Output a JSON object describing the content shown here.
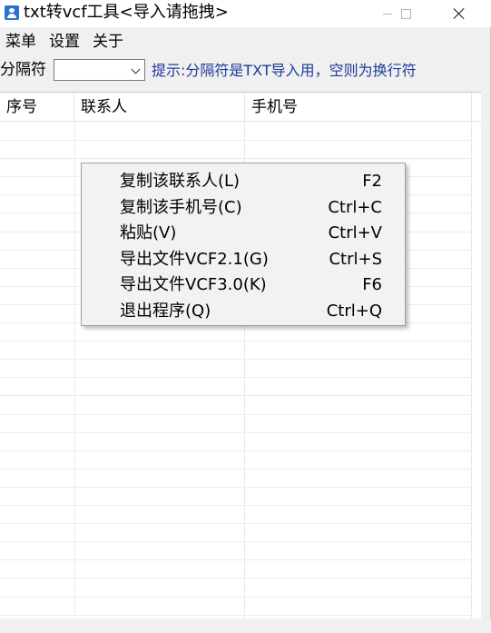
{
  "window": {
    "title": "txt转vcf工具<导入请拖拽>"
  },
  "menubar": {
    "items": [
      {
        "label": "菜单"
      },
      {
        "label": "设置"
      },
      {
        "label": "关于"
      }
    ]
  },
  "toolbar": {
    "separator_label": "分隔符",
    "separator_value": "",
    "hint": "提示:分隔符是TXT导入用，空则为换行符"
  },
  "table": {
    "columns": [
      "序号",
      "联系人",
      "手机号"
    ],
    "rows": []
  },
  "context_menu": {
    "items": [
      {
        "label": "复制该联系人(L)",
        "shortcut": "F2"
      },
      {
        "label": "复制该手机号(C)",
        "shortcut": "Ctrl+C"
      },
      {
        "label": "粘贴(V)",
        "shortcut": "Ctrl+V"
      },
      {
        "label": "导出文件VCF2.1(G)",
        "shortcut": "Ctrl+S"
      },
      {
        "label": "导出文件VCF3.0(K)",
        "shortcut": "F6"
      },
      {
        "label": "退出程序(Q)",
        "shortcut": "Ctrl+Q"
      }
    ]
  },
  "colors": {
    "hint_text": "#1e3a9a",
    "app_icon": "#2f6fcf"
  }
}
